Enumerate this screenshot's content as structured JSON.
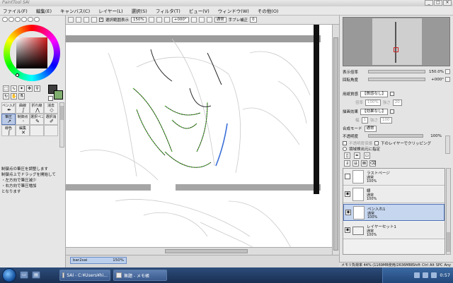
{
  "window": {
    "title": "PaintTool SAI"
  },
  "menu": [
    "ファイル(F)",
    "編集(E)",
    "キャンバス(C)",
    "レイヤー(L)",
    "選択(S)",
    "フィルタ(T)",
    "ビュー(V)",
    "ウィンドウ(W)",
    "その他(O)"
  ],
  "window_buttons": [
    "_",
    "□",
    "×"
  ],
  "canvas_toolbar": {
    "selection_label": "選択範囲表示",
    "zoom": "150%",
    "angle": "+000°",
    "blend": "通常",
    "stabilizer_label": "手ブレ補正",
    "stabilizer": "0"
  },
  "brushes": [
    {
      "label": "ペン入れ"
    },
    {
      "label": "曲線"
    },
    {
      "label": "折れ線"
    },
    {
      "label": "消去"
    },
    {
      "label": "筆圧"
    },
    {
      "label": "制御点"
    },
    {
      "label": "選択ペン"
    },
    {
      "label": "選択消"
    },
    {
      "label": "線色"
    },
    {
      "label": "編集"
    },
    {
      "label": ""
    },
    {
      "label": ""
    }
  ],
  "help_lines": [
    "制御点の筆圧を調整します",
    "制御点上でドラッグを開始して",
    "・左方向で筆圧減少",
    "・右方向で筆圧増加",
    "となります"
  ],
  "document_tab": {
    "name": "bar2sai",
    "zoom": "150%"
  },
  "panel": {
    "zoom_label": "表示倍率",
    "zoom_value": "150.0%",
    "angle_label": "回転角度",
    "angle_value": "+000°",
    "paper_label": "用紙質感",
    "paper_value": "【質感なし】",
    "paper_scale_label": "倍率",
    "paper_scale_value": "100%",
    "paper_strength_label": "強さ",
    "paper_strength_value": "20",
    "effect_label": "描画効果",
    "effect_value": "【効果なし】",
    "effect_width_label": "幅",
    "effect_width_value": "1",
    "effect_strength_label": "強さ",
    "effect_strength_value": "100",
    "blend_label": "合成モード",
    "blend_value": "通常",
    "opacity_label": "不透明度",
    "opacity_value": "100%",
    "protect_label": "不透明度保護",
    "clip_label": "下のレイヤーでクリッピング",
    "select_source_label": "領域検出元に指定"
  },
  "layers": [
    {
      "name": "ラストページ",
      "mode": "通常",
      "opacity": "100%",
      "kind": "raster",
      "selected": false
    },
    {
      "name": "線",
      "mode": "通常",
      "opacity": "100%",
      "kind": "raster",
      "selected": false
    },
    {
      "name": "ペン入れ1",
      "mode": "通常",
      "opacity": "100%",
      "kind": "pen",
      "selected": true
    },
    {
      "name": "レイヤーセット1",
      "mode": "通常",
      "opacity": "100%",
      "kind": "folder",
      "selected": false
    }
  ],
  "status": {
    "memory": "メモリ負荷率 44% (1169MB使用/2636MB確保)",
    "keys": [
      "Shift",
      "Ctrl",
      "Alt",
      "SPC",
      "Any"
    ]
  },
  "taskbar": {
    "tasks": [
      {
        "label": "SAI - C:¥Users¥hi..."
      },
      {
        "label": "無題 - メモ帳"
      }
    ],
    "clock": "0:57"
  },
  "colors": {
    "foreground": "#3d3d3d",
    "background": "#7fae6e",
    "selection_highlight": "#c6d6ef",
    "taskbar": "#1f3a66"
  }
}
